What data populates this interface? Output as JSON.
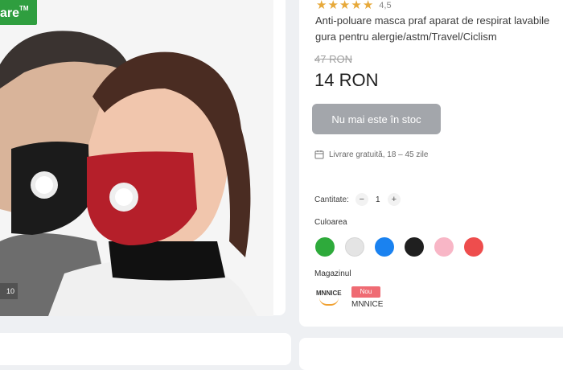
{
  "product": {
    "rating": "4,5",
    "stars": 5,
    "title_lines": [
      "Anti-poluare masca praf aparat de respirat lavabile",
      "gura pentru alergie/astm/Travel/Ciclism"
    ],
    "old_price": "47 RON",
    "price": "14 RON",
    "stock_button": "Nu mai este în stoc",
    "delivery": "Livrare gratuită, 18 – 45 zile"
  },
  "image": {
    "badge_text": "are",
    "badge_tm": "TM",
    "counter": "10"
  },
  "quantity": {
    "label": "Cantitate:",
    "minus": "−",
    "value": "1",
    "plus": "+"
  },
  "colors": {
    "label": "Culoarea",
    "swatches": [
      "#2eaa3b",
      "#e4e4e4",
      "#1a82f0",
      "#1f1f1f",
      "#f8b6c6",
      "#ee4d4d"
    ]
  },
  "shop": {
    "label": "Magazinul",
    "logo_text": "MNNICE",
    "badge": "Nou",
    "name": "MNNICE"
  }
}
